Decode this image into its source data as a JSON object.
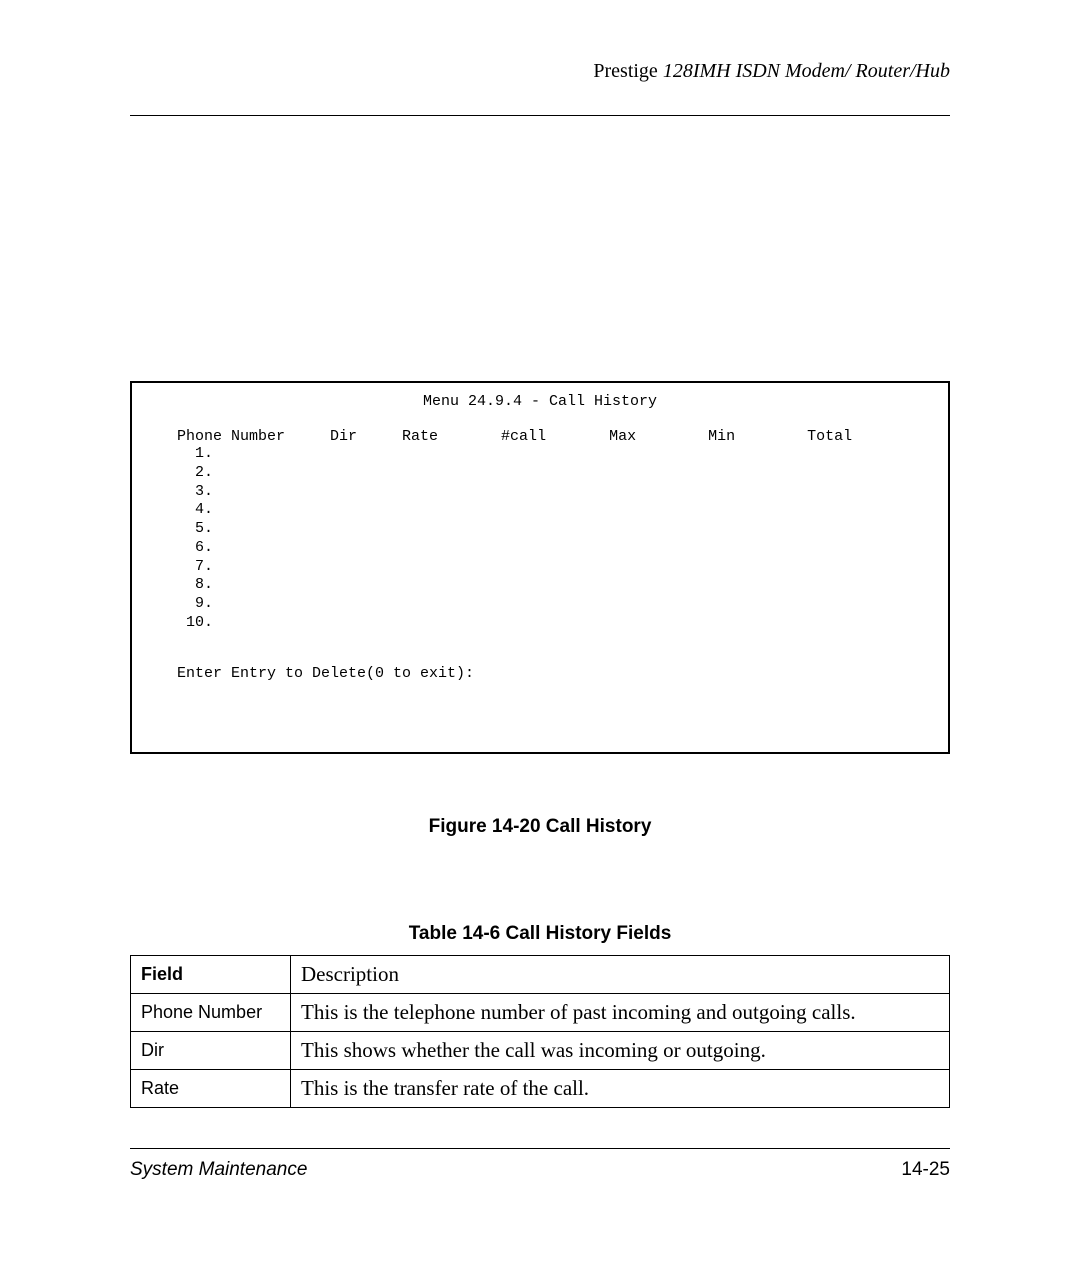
{
  "header": {
    "prefix": "Prestige",
    "suffix": "128IMH  ISDN Modem/ Router/Hub"
  },
  "menu": {
    "title": "Menu 24.9.4 - Call History",
    "columns": "   Phone Number     Dir     Rate       #call       Max        Min        Total",
    "rows": [
      "     1.",
      "     2.",
      "     3.",
      "     4.",
      "     5.",
      "     6.",
      "     7.",
      "     8.",
      "     9.",
      "    10."
    ],
    "prompt": "   Enter Entry to Delete(0 to exit):"
  },
  "figure_caption": "Figure 14-20 Call History",
  "table_caption": "Table 14-6 Call History Fields",
  "table": {
    "head": {
      "field": "Field",
      "desc": "Description"
    },
    "rows": [
      {
        "field": "Phone Number",
        "desc": "This is the telephone number of past incoming and outgoing calls."
      },
      {
        "field": "Dir",
        "desc": "This shows whether the call was incoming or outgoing."
      },
      {
        "field": "Rate",
        "desc": "This is the transfer rate of the call."
      }
    ]
  },
  "footer": {
    "left": "System Maintenance",
    "right": "14-25"
  }
}
